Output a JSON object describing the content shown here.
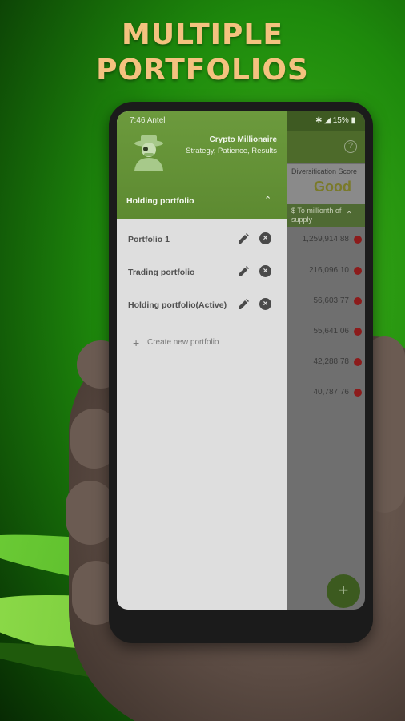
{
  "promo": {
    "headline_line1": "MULTIPLE",
    "headline_line2": "PORTFOLIOS"
  },
  "status_bar": {
    "time": "7:46 Antel",
    "battery": "15%"
  },
  "drawer": {
    "app_name": "Crypto Millionaire",
    "tagline": "Strategy, Patience, Results",
    "current_portfolio": "Holding portfolio",
    "portfolios": [
      {
        "label": "Portfolio 1"
      },
      {
        "label": "Trading portfolio"
      },
      {
        "label": "Holding portfolio(Active)"
      }
    ],
    "create_label": "Create new portfolio"
  },
  "background_app": {
    "diversification_label": "Diversification Score",
    "diversification_value": "Good",
    "supply_label": "$ To millionth of supply",
    "amounts": [
      "1,259,914.88",
      "216,096.10",
      "56,603.77",
      "55,641.06",
      "42,288.78",
      "40,787.76"
    ]
  },
  "colors": {
    "accent": "#5d8a31",
    "headline": "#f4c27f",
    "danger": "#8c1b1b"
  }
}
